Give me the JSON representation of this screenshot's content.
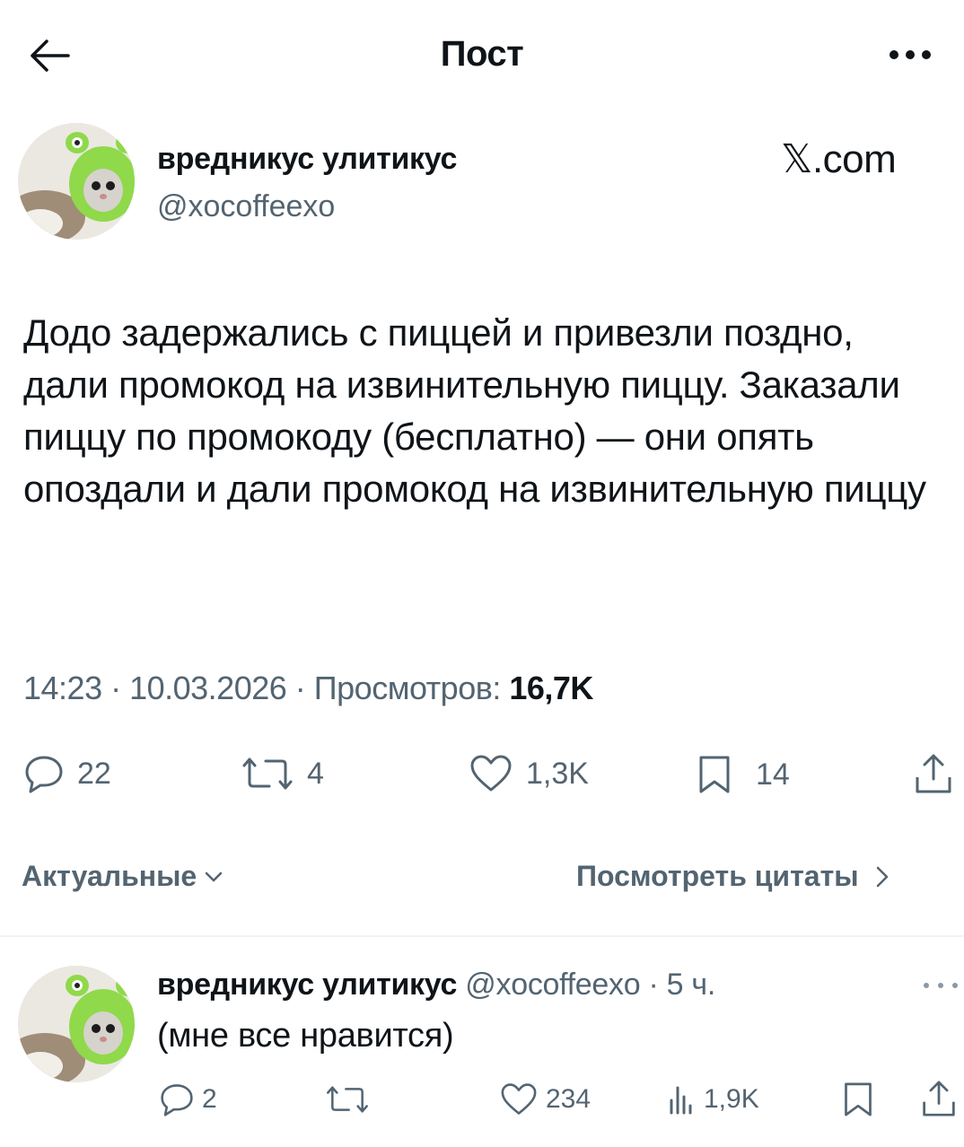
{
  "header": {
    "title": "Пост"
  },
  "post": {
    "author_name": "вредникус улитикус",
    "author_handle": "@xocoffeexo",
    "watermark": "𝕏.com",
    "text": "Додо задержались с пиццей и привезли поздно, дали промокод на извинительную пиццу. Заказали пиццу по промокоду (бесплатно) — они опять опоздали и дали промокод на извинительную пиццу",
    "time": "14:23",
    "date": "10.03.2026",
    "views_label": "Просмотров:",
    "views_value": "16,7K",
    "meta_sep": " · "
  },
  "actions": {
    "replies": "22",
    "reposts": "4",
    "likes": "1,3K",
    "bookmarks": "14"
  },
  "filters": {
    "sort_label": "Актуальные",
    "quotes_label": "Посмотреть цитаты"
  },
  "reply": {
    "author_name": "вредникус улитикус",
    "author_handle": "@xocoffeexo",
    "time": "5 ч.",
    "sep": " · ",
    "text": "(мне все нравится)",
    "replies": "2",
    "likes": "234",
    "views": "1,9K"
  },
  "colors": {
    "text": "#0f1419",
    "muted": "#536471",
    "divider": "#eff3f4",
    "frog_hat": "#8fd94a"
  },
  "icons": [
    "back-arrow-icon",
    "more-icon",
    "reply-icon",
    "repost-icon",
    "like-icon",
    "bookmark-icon",
    "share-icon",
    "views-icon",
    "chevron-down-icon",
    "chevron-right-icon"
  ]
}
